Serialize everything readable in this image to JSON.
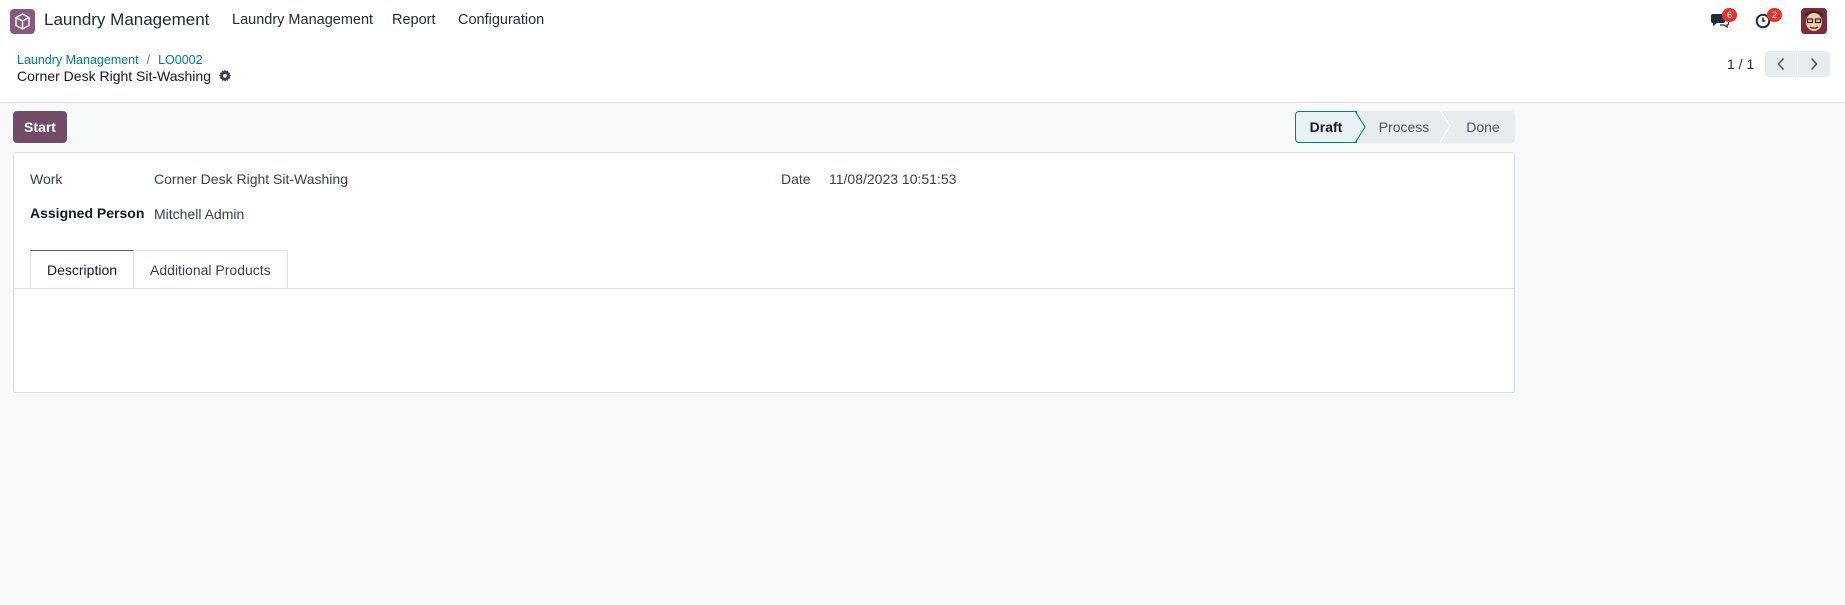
{
  "navbar": {
    "app_name": "Laundry Management",
    "menu": [
      "Laundry Management",
      "Report",
      "Configuration"
    ],
    "messages_count": "6",
    "activities_count": "2"
  },
  "breadcrumb": {
    "parent": "Laundry Management",
    "separator": "/",
    "current": "LO0002"
  },
  "record_title": "Corner Desk Right Sit-Washing",
  "pager": {
    "value": "1 / 1"
  },
  "actions": {
    "start_label": "Start"
  },
  "statusbar": {
    "stages": [
      "Draft",
      "Process",
      "Done"
    ],
    "active": "Draft"
  },
  "form": {
    "work_label": "Work",
    "work_value": "Corner Desk Right Sit-Washing",
    "assigned_label": "Assigned Person",
    "assigned_value": "Mitchell Admin",
    "date_label": "Date",
    "date_value": "11/08/2023 10:51:53"
  },
  "tabs": [
    "Description",
    "Additional Products"
  ],
  "colors": {
    "brand": "#714b67",
    "link": "#017e84",
    "badge": "#e3342f"
  }
}
